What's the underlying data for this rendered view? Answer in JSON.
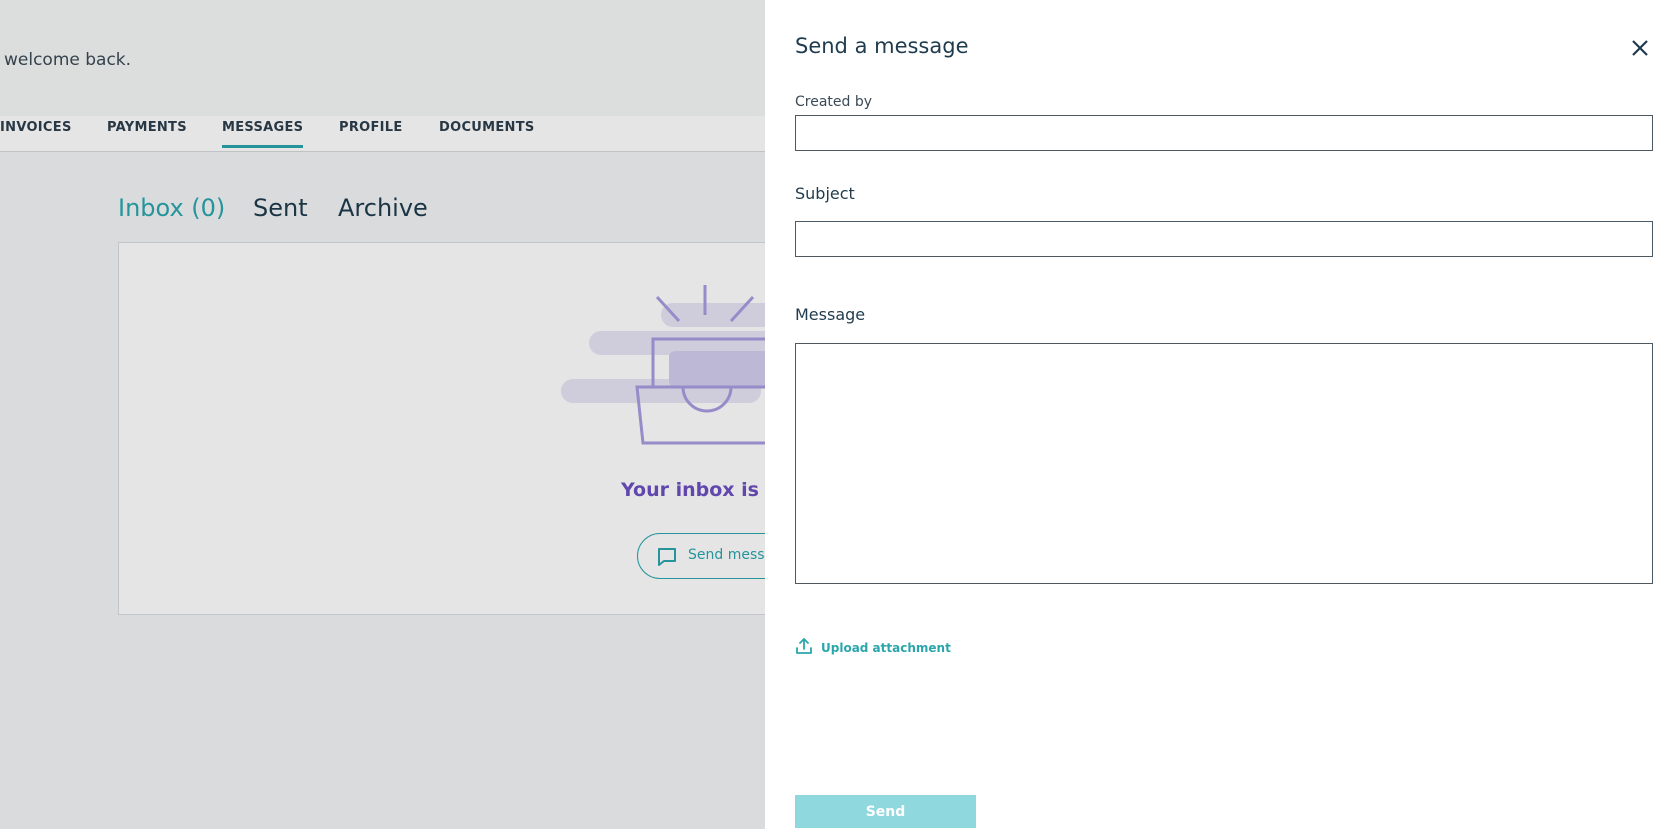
{
  "background": {
    "welcome_text": "welcome back.",
    "nav": {
      "items": [
        {
          "label": "INVOICES"
        },
        {
          "label": "PAYMENTS"
        },
        {
          "label": "MESSAGES",
          "active": true
        },
        {
          "label": "PROFILE"
        },
        {
          "label": "DOCUMENTS"
        }
      ]
    },
    "tabs": {
      "inbox": "Inbox (0)",
      "sent": "Sent",
      "archive": "Archive"
    },
    "empty_state": {
      "text": "Your inbox is em",
      "button_label": "Send messa",
      "icon": "inbox-illustration"
    }
  },
  "drawer": {
    "title": "Send a message",
    "close_icon": "close-icon",
    "created_by": {
      "label": "Created by",
      "value": ""
    },
    "subject": {
      "label": "Subject",
      "value": ""
    },
    "message": {
      "label": "Message",
      "value": ""
    },
    "upload": {
      "label": "Upload attachment",
      "icon": "upload-icon"
    },
    "send_label": "Send"
  },
  "colors": {
    "accent": "#2aa6ad",
    "send_disabled": "#8fd8de",
    "empty_text": "#6d4fc2",
    "illustration": "#a99be0"
  }
}
